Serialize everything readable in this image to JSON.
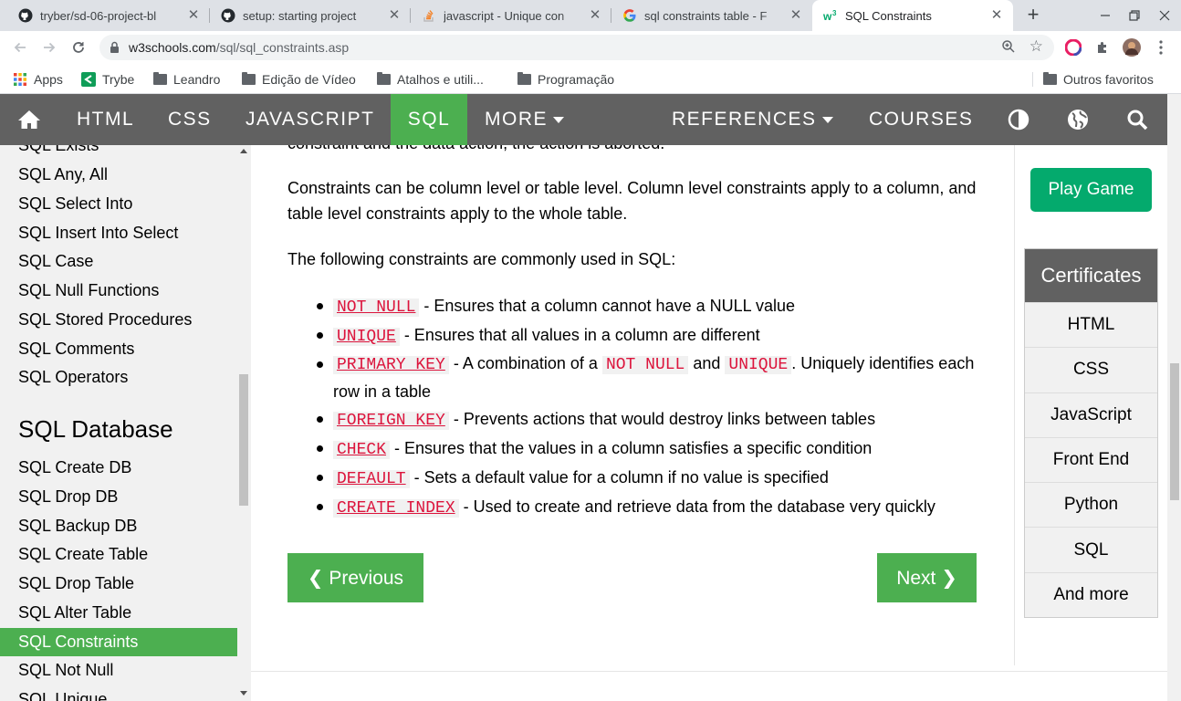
{
  "browser": {
    "tabs": [
      {
        "title": "tryber/sd-06-project-bl",
        "icon": "github-icon",
        "active": false
      },
      {
        "title": "setup: starting project",
        "icon": "github-icon",
        "active": false
      },
      {
        "title": "javascript - Unique con",
        "icon": "stackoverflow-icon",
        "active": false
      },
      {
        "title": "sql constraints table - F",
        "icon": "google-icon",
        "active": false
      },
      {
        "title": "SQL Constraints",
        "icon": "w3schools-icon",
        "active": true
      }
    ],
    "address": {
      "domain": "w3schools.com",
      "path": "/sql/sql_constraints.asp"
    },
    "bookmarks": [
      {
        "label": "Apps",
        "icon": "apps-grid-icon"
      },
      {
        "label": "Trybe",
        "icon": "trybe-icon"
      },
      {
        "label": "Leandro",
        "icon": "folder-icon"
      },
      {
        "label": "Edição de Vídeo",
        "icon": "folder-icon"
      },
      {
        "label": "Atalhos e utili...",
        "icon": "folder-icon"
      },
      {
        "label": "Programação",
        "icon": "folder-icon"
      },
      {
        "label": "Outros favoritos",
        "icon": "folder-icon"
      }
    ]
  },
  "topnav": {
    "items": [
      "HTML",
      "CSS",
      "JAVASCRIPT",
      "SQL",
      "MORE",
      "REFERENCES",
      "COURSES"
    ],
    "active": "SQL"
  },
  "sidebar": {
    "links_top": [
      "SQL Exists",
      "SQL Any, All",
      "SQL Select Into",
      "SQL Insert Into Select",
      "SQL Case",
      "SQL Null Functions",
      "SQL Stored Procedures",
      "SQL Comments",
      "SQL Operators"
    ],
    "section_heading": "SQL Database",
    "links_db": [
      "SQL Create DB",
      "SQL Drop DB",
      "SQL Backup DB",
      "SQL Create Table",
      "SQL Drop Table",
      "SQL Alter Table",
      "SQL Constraints",
      "SQL Not Null",
      "SQL Unique"
    ],
    "active": "SQL Constraints"
  },
  "content": {
    "partial_line": "constraint and the data action, the action is aborted.",
    "para1": "Constraints can be column level or table level. Column level constraints apply to a column, and table level constraints apply to the whole table.",
    "para2": "The following constraints are commonly used in SQL:",
    "constraints": [
      {
        "code": "NOT NULL",
        "desc": " - Ensures that a column cannot have a NULL value"
      },
      {
        "code": "UNIQUE",
        "desc": " - Ensures that all values in a column are different"
      },
      {
        "code": "PRIMARY KEY",
        "desc_a": " - A combination of a ",
        "code_b": "NOT NULL",
        "desc_b": " and ",
        "code_c": "UNIQUE",
        "desc_c": ". Uniquely identifies each row in a table"
      },
      {
        "code": "FOREIGN KEY",
        "desc": " - Prevents actions that would destroy links between tables"
      },
      {
        "code": "CHECK",
        "desc": " - Ensures that the values in a column satisfies a specific condition"
      },
      {
        "code": "DEFAULT",
        "desc": " - Sets a default value for a column if no value is specified"
      },
      {
        "code": "CREATE INDEX",
        "desc": " - Used to create and retrieve data from the database very quickly"
      }
    ],
    "prev_label": "❮ Previous",
    "next_label": "Next ❯"
  },
  "right": {
    "play_label": "Play Game",
    "certs_heading": "Certificates",
    "certs": [
      "HTML",
      "CSS",
      "JavaScript",
      "Front End",
      "Python",
      "SQL",
      "And more"
    ]
  },
  "colors": {
    "accent": "#4caf50",
    "nav": "#616161",
    "play": "#04aa6d",
    "code": "#dc143c"
  }
}
